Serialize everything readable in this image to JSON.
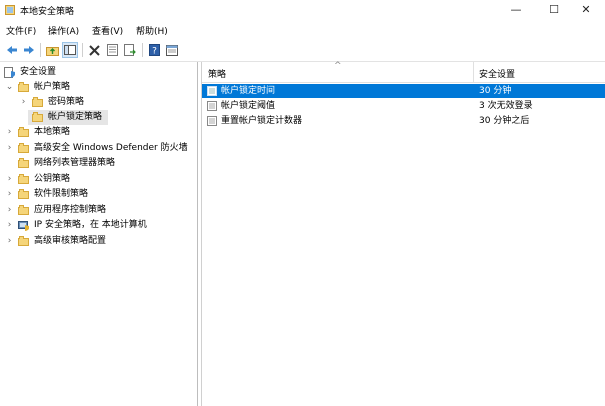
{
  "window": {
    "title": "本地安全策略",
    "buttons": {
      "minimize": "—",
      "maximize": "☐",
      "close": "✕"
    }
  },
  "menu": [
    {
      "label": "文件(F)"
    },
    {
      "label": "操作(A)"
    },
    {
      "label": "查看(V)"
    },
    {
      "label": "帮助(H)"
    }
  ],
  "toolbar": {
    "icons": [
      "back-icon",
      "forward-icon",
      "up-folder-icon",
      "show-hide-tree-icon",
      "delete-icon",
      "properties-icon",
      "export-list-icon",
      "help-icon",
      "console-icon"
    ]
  },
  "tree": {
    "root": "安全设置",
    "items": [
      {
        "label": "帐户策略"
      },
      {
        "label": "密码策略"
      },
      {
        "label": "帐户锁定策略"
      },
      {
        "label": "本地策略"
      },
      {
        "label": "高级安全 Windows Defender 防火墙"
      },
      {
        "label": "网络列表管理器策略"
      },
      {
        "label": "公钥策略"
      },
      {
        "label": "软件限制策略"
      },
      {
        "label": "应用程序控制策略"
      },
      {
        "label": "IP 安全策略，在 本地计算机"
      },
      {
        "label": "高级审核策略配置"
      }
    ]
  },
  "list": {
    "columns": [
      "策略",
      "安全设置"
    ],
    "rows": [
      {
        "policy": "帐户锁定时间",
        "setting": "30 分钟",
        "selected": true
      },
      {
        "policy": "帐户锁定阈值",
        "setting": "3 次无效登录",
        "selected": false
      },
      {
        "policy": "重置帐户锁定计数器",
        "setting": "30 分钟之后",
        "selected": false
      }
    ]
  },
  "colors": {
    "selection": "#0078d7",
    "folder": "#f5d57a",
    "tree_selection": "#e5e5e5"
  }
}
